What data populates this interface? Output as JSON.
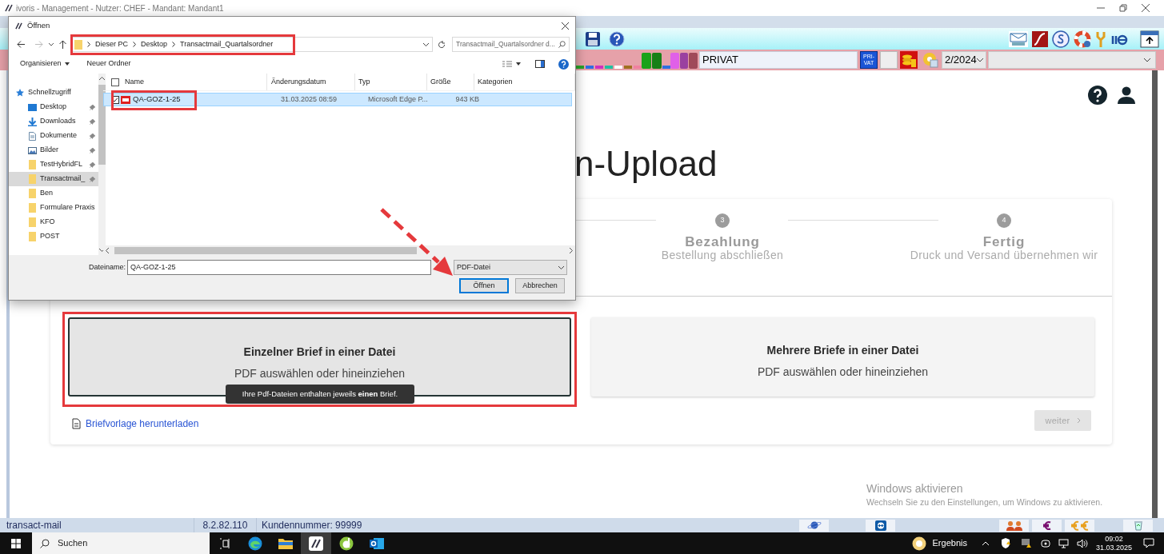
{
  "window": {
    "title": "ivoris - Management - Nutzer: CHEF - Mandant: Mandant1"
  },
  "toolbar": {
    "name_field": "PRIVAT",
    "privat_badge": [
      "PRI-",
      "VAT"
    ],
    "period_select": "2/2024"
  },
  "page": {
    "heading": "n-Upload",
    "steps": [
      {
        "number": "3",
        "title": "Bezahlung",
        "subtitle": "Bestellung abschließen"
      },
      {
        "number": "4",
        "title": "Fertig",
        "subtitle": "Druck und Versand übernehmen wir"
      }
    ],
    "options": [
      {
        "title": "Einzelner Brief in einer Datei",
        "hint": "PDF auswählen oder hineinziehen",
        "selected": true
      },
      {
        "title": "Mehrere Briefe in einer Datei",
        "hint": "PDF auswählen oder hineinziehen",
        "selected": false
      }
    ],
    "tooltip": "Ihre Pdf-Dateien enthalten jeweils **einen** Brief.",
    "template_link": "Briefvorlage herunterladen",
    "next_button": {
      "label": "weiter",
      "disabled": true
    }
  },
  "activation_notice": {
    "title": "Windows aktivieren",
    "text": "Wechseln Sie zu den Einstellungen, um Windows zu aktivieren."
  },
  "status_bar": {
    "cells": [
      "transact-mail",
      "8.2.82.110",
      "Kundennummer: 99999"
    ]
  },
  "taskbar": {
    "search_placeholder": "Suchen",
    "weather": "Ergebnis",
    "time": "09:02",
    "date": "31.03.2025"
  },
  "dialog": {
    "title": "Öffnen",
    "path": [
      "Dieser PC",
      "Desktop",
      "Transactmail_Quartalsordner"
    ],
    "search_placeholder": "Transactmail_Quartalsordner d...",
    "toolbar": [
      "Organisieren",
      "Neuer Ordner"
    ],
    "nav": [
      {
        "label": "Schnellzugriff",
        "kind": "star",
        "pinned": false,
        "selected": false
      },
      {
        "label": "Desktop",
        "kind": "desktop",
        "pinned": true,
        "selected": false
      },
      {
        "label": "Downloads",
        "kind": "download",
        "pinned": true,
        "selected": false
      },
      {
        "label": "Dokumente",
        "kind": "document",
        "pinned": true,
        "selected": false
      },
      {
        "label": "Bilder",
        "kind": "images",
        "pinned": true,
        "selected": false
      },
      {
        "label": "TestHybridFL",
        "kind": "folder",
        "pinned": true,
        "selected": false
      },
      {
        "label": "Transactmail_",
        "kind": "folder",
        "pinned": true,
        "selected": true
      },
      {
        "label": "Ben",
        "kind": "folder",
        "pinned": false,
        "selected": false
      },
      {
        "label": "Formulare Praxis",
        "kind": "folder",
        "pinned": false,
        "selected": false
      },
      {
        "label": "KFO",
        "kind": "folder",
        "pinned": false,
        "selected": false
      },
      {
        "label": "POST",
        "kind": "folder",
        "pinned": false,
        "selected": false
      }
    ],
    "select_all_checked": false,
    "columns": [
      "Name",
      "Änderungsdatum",
      "Typ",
      "Größe",
      "Kategorien"
    ],
    "files": [
      {
        "cells": [
          "QA-GOZ-1-25",
          "31.03.2025 08:59",
          "Microsoft Edge P...",
          "943 KB"
        ],
        "selected": true,
        "checked": true
      }
    ],
    "file_name_label": "Dateiname:",
    "file_name": "QA-GOZ-1-25",
    "file_type": "PDF-Datei",
    "buttons": [
      "Öffnen",
      "Abbrechen"
    ]
  }
}
